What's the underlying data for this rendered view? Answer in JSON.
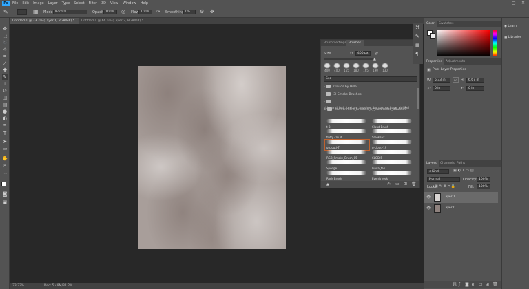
{
  "app": {
    "logo": "Ps"
  },
  "menu": [
    "File",
    "Edit",
    "Image",
    "Layer",
    "Type",
    "Select",
    "Filter",
    "3D",
    "View",
    "Window",
    "Help"
  ],
  "window_controls": {
    "minimize": "–",
    "maximize": "□",
    "close": "✕"
  },
  "options": {
    "mode_label": "Mode:",
    "mode_value": "Normal",
    "opacity_label": "Opacity:",
    "opacity_value": "100%",
    "flow_label": "Flow:",
    "flow_value": "100%",
    "smoothing_label": "Smoothing:",
    "smoothing_value": "0%"
  },
  "tabs": [
    "Untitled-1 @ 33.3% (Layer 1, RGB/8#) *",
    "Untitled-1 @ 66.6% (Layer 2, RGB/8#) *"
  ],
  "status": {
    "zoom": "33.33%",
    "doc": "Doc: 5.49M/31.2M"
  },
  "brush_panel": {
    "tabs": [
      "Brush Settings",
      "Brushes"
    ],
    "size_label": "Size",
    "size_value": "400 px",
    "tips": [
      "400",
      "400",
      "155",
      "180",
      "165",
      "190",
      "130"
    ],
    "search_placeholder": "Sea",
    "folders": [
      "Clouds by Hille",
      "3I Smoke Brushes",
      "skin_and_hair_texture_brushes_by_castrachaos_d4lj8el",
      "environment_brushes_by_dawnpaba_d5uh6x3"
    ],
    "brushes": [
      "t-3",
      "Cloud Brush",
      "fluffy cloud",
      "Smoke5x",
      "g-cloud-7",
      "g-cloud-19",
      "RGB_Smoke_Brush_05",
      "CLOD 5",
      "Sponge",
      "Linda_fan",
      "Rock Brush",
      "Evenly rock"
    ]
  },
  "color_panel": {
    "tabs": [
      "Color",
      "Swatches"
    ]
  },
  "properties_panel": {
    "tabs": [
      "Properties",
      "Adjustments"
    ],
    "title": "Pixel Layer Properties",
    "w_label": "W:",
    "w_value": "5.33 in",
    "h_label": "H:",
    "h_value": "6.67 in",
    "link_label": "GO",
    "x_label": "X:",
    "x_value": "0 in",
    "y_label": "Y:",
    "y_value": "0 in"
  },
  "layers_panel": {
    "tabs": [
      "Layers",
      "Channels",
      "Paths"
    ],
    "kind": "Kind",
    "blend": "Normal",
    "opacity_label": "Opacity:",
    "opacity_value": "100%",
    "lock_label": "Lock:",
    "fill_label": "Fill:",
    "fill_value": "100%",
    "layers": [
      "Layer 1",
      "Layer 0"
    ]
  },
  "far_right": {
    "learn": "Learn",
    "libraries": "Libraries"
  },
  "colors": {
    "accent": "#31a8ff",
    "selection": "#c0622e",
    "canvas_bg": "#282828",
    "panel_bg": "#535353"
  }
}
